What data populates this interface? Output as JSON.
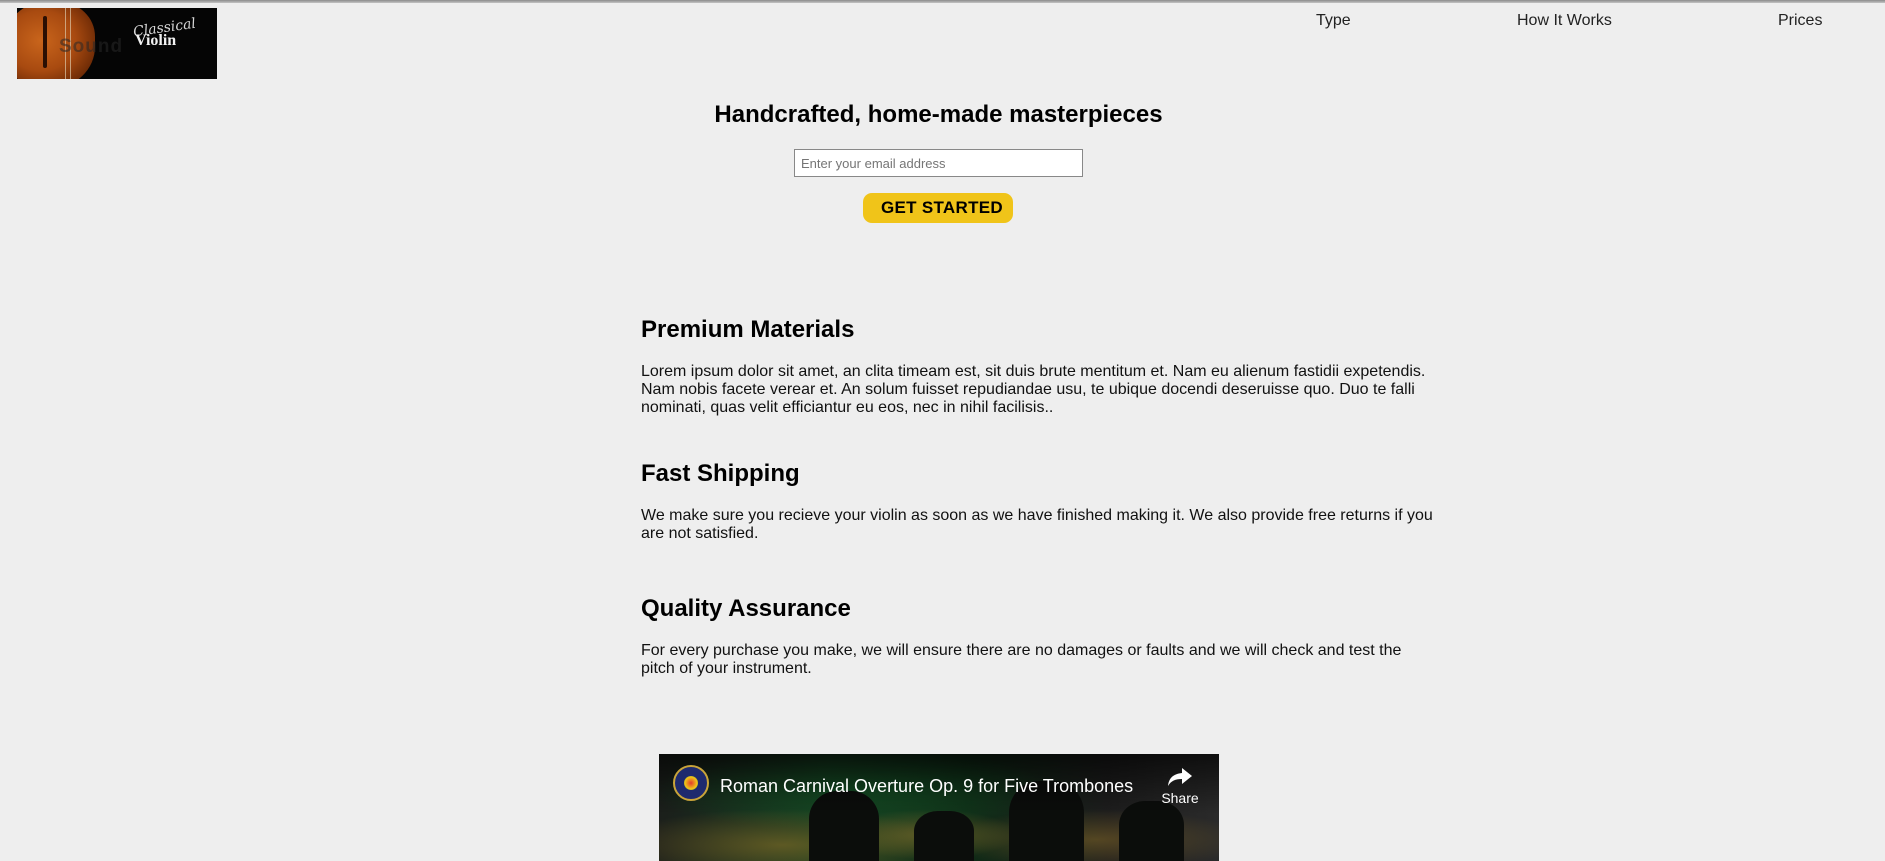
{
  "header": {
    "logo": {
      "script_text": "Classical",
      "word_text": "Violin",
      "faded_text": "Sound"
    },
    "nav": [
      {
        "label": "Type"
      },
      {
        "label": "How It Works"
      },
      {
        "label": "Prices"
      }
    ]
  },
  "hero": {
    "title": "Handcrafted, home-made masterpieces",
    "email_placeholder": "Enter your email address",
    "cta_label": "GET STARTED",
    "cta_color": "#f0c419"
  },
  "features": [
    {
      "title": "Premium Materials",
      "text": "Lorem ipsum dolor sit amet, an clita timeam est, sit duis brute mentitum et. Nam eu alienum fastidii expetendis. Nam nobis facete verear et. An solum fuisset repudiandae usu, te ubique docendi deseruisse quo. Duo te falli nominati, quas velit efficiantur eu eos, nec in nihil facilisis.."
    },
    {
      "title": "Fast Shipping",
      "text": "We make sure you recieve your violin as soon as we have finished making it. We also provide free returns if you are not satisfied."
    },
    {
      "title": "Quality Assurance",
      "text": "For every purchase you make, we will ensure there are no damages or faults and we will check and test the pitch of your instrument."
    }
  ],
  "video": {
    "title": "Roman Carnival Overture Op. 9 for Five Trombones",
    "share_label": "Share",
    "share_icon": "share-arrow-icon"
  },
  "colors": {
    "page_background": "#eeeeee",
    "accent": "#f0c419"
  }
}
